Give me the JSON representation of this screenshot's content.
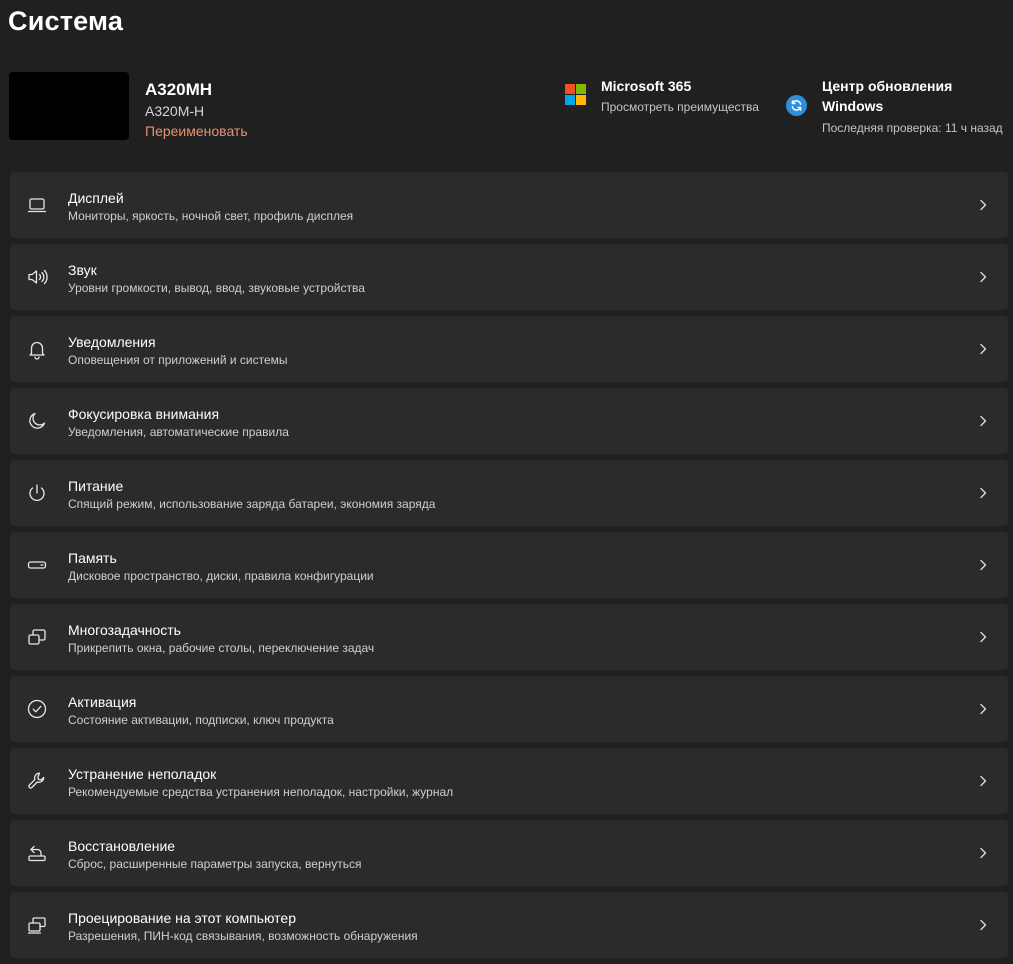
{
  "page": {
    "title": "Система"
  },
  "device": {
    "name": "A320MH",
    "model": "A320M-H",
    "rename_label": "Переименовать"
  },
  "tiles": {
    "microsoft365": {
      "title": "Microsoft 365",
      "subtitle": "Просмотреть преимущества",
      "icon": "microsoft-logo-icon",
      "colors": [
        "#f25022",
        "#7fba00",
        "#00a4ef",
        "#ffb900"
      ]
    },
    "windows_update": {
      "title_line1": "Центр обновления",
      "title_line2": "Windows",
      "subtitle": "Последняя проверка: 11 ч назад",
      "icon": "windows-update-icon",
      "color": "#2b8fde"
    }
  },
  "settings": {
    "items": [
      {
        "title": "Дисплей",
        "subtitle": "Мониторы, яркость, ночной свет, профиль дисплея",
        "icon": "display-icon"
      },
      {
        "title": "Звук",
        "subtitle": "Уровни громкости, вывод, ввод, звуковые устройства",
        "icon": "sound-icon"
      },
      {
        "title": "Уведомления",
        "subtitle": "Оповещения от приложений и системы",
        "icon": "bell-icon"
      },
      {
        "title": "Фокусировка внимания",
        "subtitle": "Уведомления, автоматические правила",
        "icon": "moon-icon"
      },
      {
        "title": "Питание",
        "subtitle": "Спящий режим, использование заряда батареи, экономия заряда",
        "icon": "power-icon"
      },
      {
        "title": "Память",
        "subtitle": "Дисковое пространство, диски, правила конфигурации",
        "icon": "storage-icon"
      },
      {
        "title": "Многозадачность",
        "subtitle": "Прикрепить окна, рабочие столы, переключение задач",
        "icon": "multitasking-icon"
      },
      {
        "title": "Активация",
        "subtitle": "Состояние активации, подписки, ключ продукта",
        "icon": "checkmark-circle-icon"
      },
      {
        "title": "Устранение неполадок",
        "subtitle": "Рекомендуемые средства устранения неполадок, настройки, журнал",
        "icon": "wrench-icon"
      },
      {
        "title": "Восстановление",
        "subtitle": "Сброс, расширенные параметры запуска, вернуться",
        "icon": "recovery-icon"
      },
      {
        "title": "Проецирование на этот компьютер",
        "subtitle": "Разрешения, ПИН-код связывания, возможность обнаружения",
        "icon": "projection-icon"
      }
    ]
  },
  "theme": {
    "background": "#202020",
    "card": "#2b2b2b",
    "accent_link": "#e59372"
  }
}
